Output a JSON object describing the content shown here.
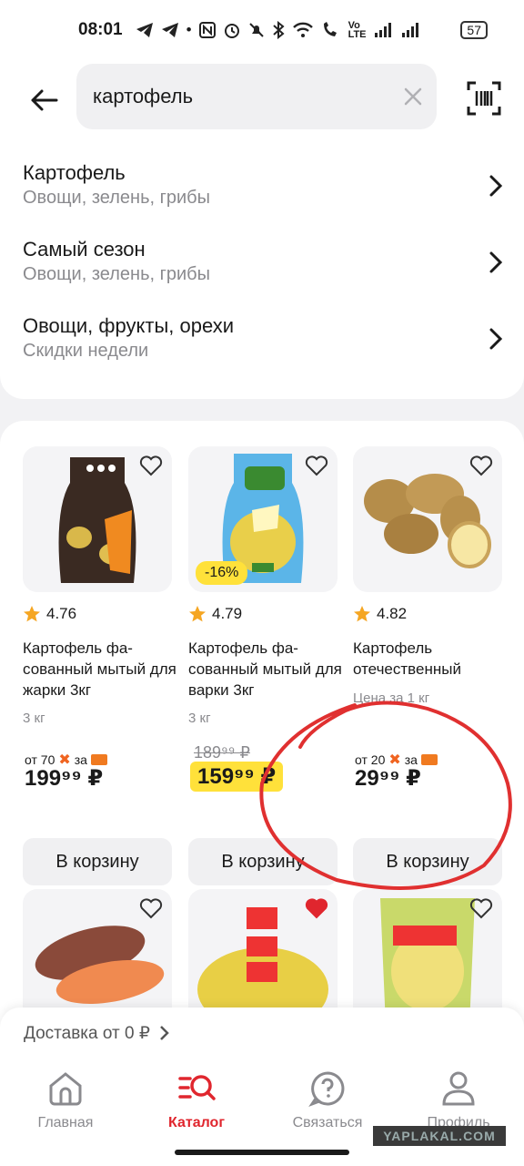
{
  "status": {
    "time": "08:01",
    "battery": "57",
    "icons": [
      "telegram-icon",
      "telegram-icon",
      "dot-icon",
      "nfc-icon",
      "alarm-icon",
      "mute-icon",
      "bluetooth-icon",
      "wifi-icon",
      "wifi-call-icon",
      "volte-icon",
      "signal-icon",
      "signal-icon"
    ]
  },
  "search": {
    "value": "картофель"
  },
  "suggestions": [
    {
      "title": "Картофель",
      "subtitle": "Овощи, зелень, грибы"
    },
    {
      "title": "Самый сезон",
      "subtitle": "Овощи, зелень, грибы"
    },
    {
      "title": "Овощи, фрукты, орехи",
      "subtitle": "Скидки недели"
    }
  ],
  "products": [
    {
      "rating": "4.76",
      "name": "Картофель фа-сованный мытый для жарки 3кг",
      "weight": "3 кг",
      "bonus_from": "от 70",
      "bonus_for": "за",
      "price": "199⁹⁹ ₽",
      "cart": "В корзину",
      "favorite": false
    },
    {
      "rating": "4.79",
      "name": "Картофель фа-сованный мытый для варки 3кг",
      "weight": "3 кг",
      "discount": "-16%",
      "old_price": "189⁹⁹ ₽",
      "price": "159⁹⁹ ₽",
      "cart": "В корзину",
      "favorite": false
    },
    {
      "rating": "4.82",
      "name": "Картофель отечественный",
      "weight": "Цена за 1 кг",
      "bonus_from": "от 20",
      "bonus_for": "за",
      "price": "29⁹⁹ ₽",
      "cart": "В корзину",
      "favorite": false
    }
  ],
  "second_row_favorites": [
    false,
    true,
    false
  ],
  "delivery": {
    "text": "Доставка от 0 ₽"
  },
  "nav": [
    {
      "label": "Главная",
      "icon": "home-icon",
      "active": false
    },
    {
      "label": "Каталог",
      "icon": "catalog-search-icon",
      "active": true
    },
    {
      "label": "Связаться",
      "icon": "support-icon",
      "active": false
    },
    {
      "label": "Профиль",
      "icon": "profile-icon",
      "active": false
    }
  ],
  "watermark": "YAPLAKAL.COM",
  "colors": {
    "accent": "#e0262e",
    "highlight": "#ffe13a",
    "bonus": "#f06420",
    "annotation": "#e03030"
  }
}
